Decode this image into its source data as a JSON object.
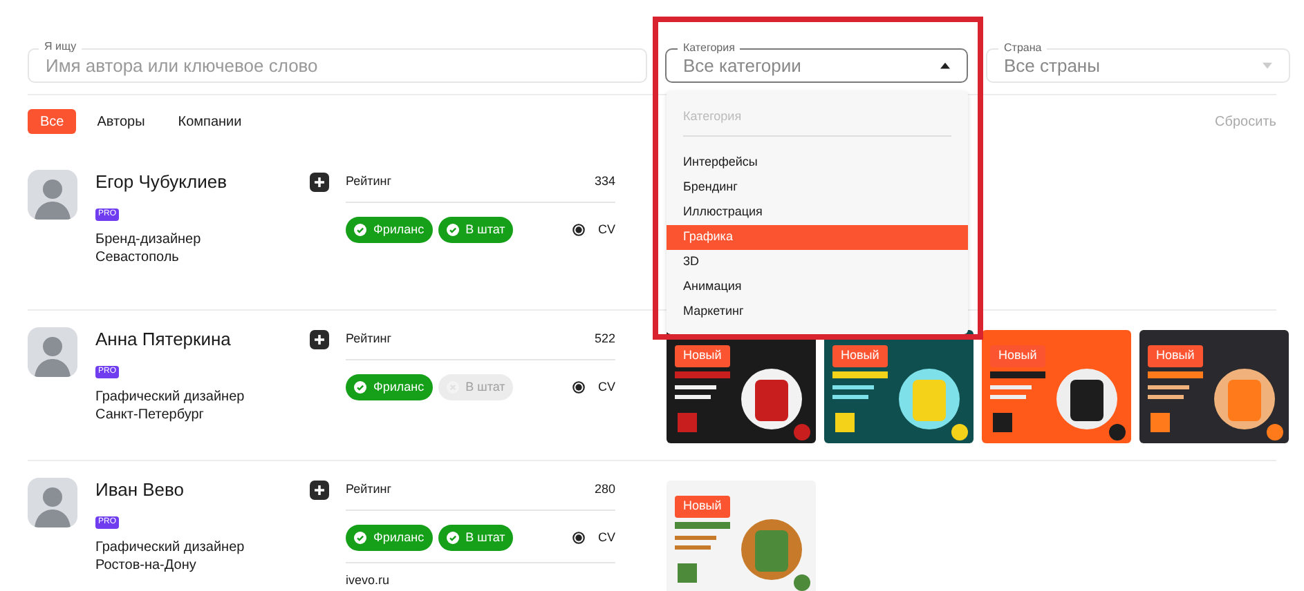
{
  "search": {
    "label": "Я ищу",
    "placeholder": "Имя автора или ключевое слово"
  },
  "category_select": {
    "label": "Категория",
    "value": "Все категории",
    "expanded": true
  },
  "country_select": {
    "label": "Страна",
    "value": "Все страны",
    "expanded": false
  },
  "tabs": [
    {
      "label": "Все",
      "selected": true
    },
    {
      "label": "Авторы",
      "selected": false
    },
    {
      "label": "Компании",
      "selected": false
    }
  ],
  "reset": "Сбросить",
  "category_menu": {
    "header": "Категория",
    "options": [
      {
        "label": "Интерфейсы",
        "selected": false
      },
      {
        "label": "Брендинг",
        "selected": false
      },
      {
        "label": "Иллюстрация",
        "selected": false
      },
      {
        "label": "Графика",
        "selected": true
      },
      {
        "label": "3D",
        "selected": false
      },
      {
        "label": "Анимация",
        "selected": false
      },
      {
        "label": "Маркетинг",
        "selected": false
      }
    ]
  },
  "authors": [
    {
      "name": "Егор Чубуклиев",
      "pro": "PRO",
      "role": "Бренд-дизайнер",
      "city": "Севастополь",
      "rating_label": "Рейтинг",
      "rating": "334",
      "badges": [
        {
          "label": "Фриланс",
          "active": true
        },
        {
          "label": "В штат",
          "active": true
        }
      ],
      "cv": "CV"
    },
    {
      "name": "Анна Пятеркина",
      "pro": "PRO",
      "role": "Графический дизайнер",
      "city": "Санкт-Петербург",
      "rating_label": "Рейтинг",
      "rating": "522",
      "badges": [
        {
          "label": "Фриланс",
          "active": true
        },
        {
          "label": "В штат",
          "active": false
        }
      ],
      "cv": "CV",
      "projects": [
        {
          "badge": "Новый"
        },
        {
          "badge": "Новый"
        },
        {
          "badge": "Новый"
        },
        {
          "badge": "Новый"
        }
      ]
    },
    {
      "name": "Иван Вево",
      "pro": "PRO",
      "role": "Графический дизайнер",
      "city": "Ростов-на-Дону",
      "rating_label": "Рейтинг",
      "rating": "280",
      "badges": [
        {
          "label": "Фриланс",
          "active": true
        },
        {
          "label": "В штат",
          "active": true
        }
      ],
      "cv": "CV",
      "website": "ivevo.ru",
      "projects": [
        {
          "badge": "Новый"
        }
      ]
    }
  ]
}
